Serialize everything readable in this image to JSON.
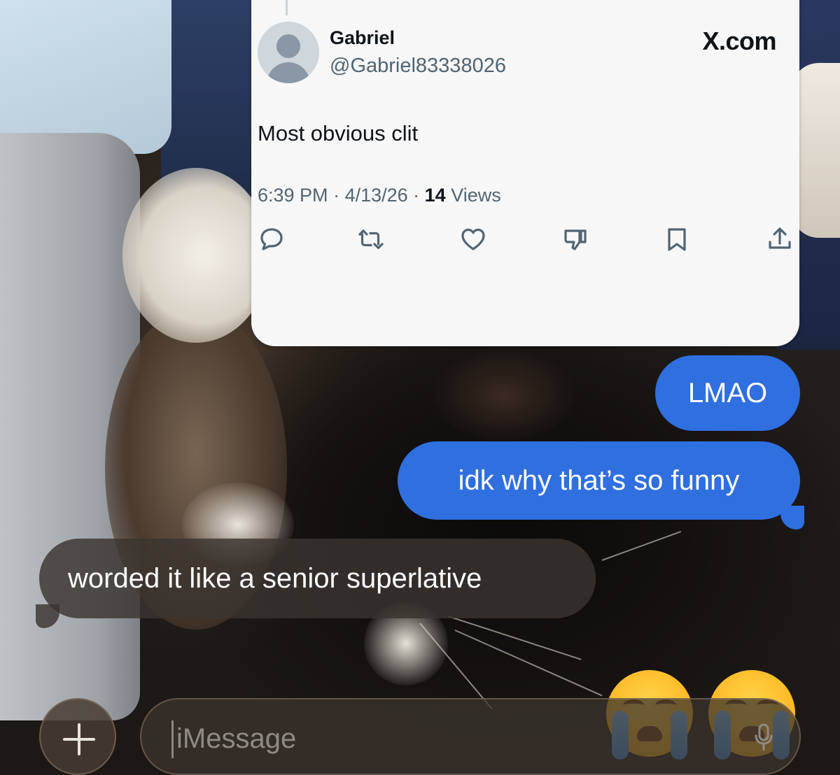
{
  "tweet": {
    "name": "Gabriel",
    "handle": "@Gabriel83338026",
    "brand": "X.com",
    "text": "Most obvious clit",
    "time": "6:39 PM",
    "date": "4/13/26",
    "views_count": "14",
    "views_label": "Views",
    "actions": [
      "reply-icon",
      "retweet-icon",
      "like-icon",
      "dislike-icon",
      "bookmark-icon",
      "share-icon"
    ]
  },
  "messages": [
    {
      "direction": "sent",
      "text": "LMAO"
    },
    {
      "direction": "sent",
      "text": "idk why that’s so funny"
    },
    {
      "direction": "received",
      "text": "worded it like a senior superlative"
    }
  ],
  "reaction_emoji": [
    "loudly-crying-face",
    "loudly-crying-face"
  ],
  "composer": {
    "placeholder": "iMessage"
  },
  "colors": {
    "sent_bubble": "#2f6fe0",
    "received_bubble": "#3a3430",
    "tweet_background": "#f7f7f8",
    "tweet_secondary_text": "#536471"
  }
}
